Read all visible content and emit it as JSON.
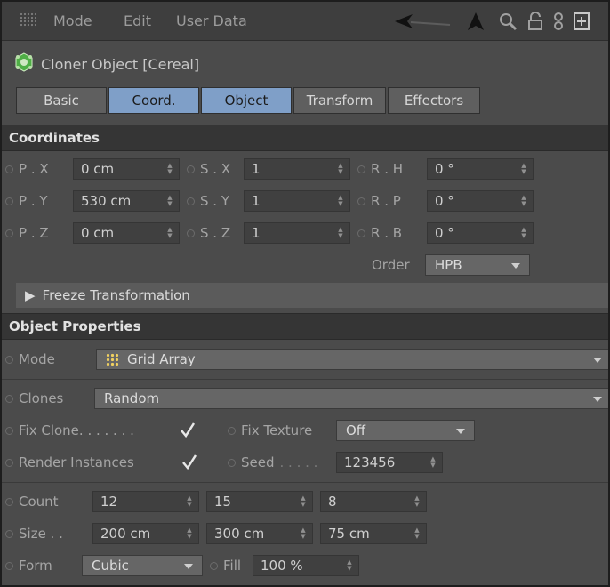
{
  "menubar": {
    "items": [
      "Mode",
      "Edit",
      "User Data"
    ],
    "icons": [
      "back-arrow-icon",
      "cursor-arrow-icon",
      "search-icon",
      "lock-icon",
      "link-icon",
      "new-panel-icon"
    ]
  },
  "object": {
    "title": "Cloner Object [Cereal]",
    "icon": "cloner-icon"
  },
  "tabs": [
    {
      "label": "Basic",
      "active": false
    },
    {
      "label": "Coord.",
      "active": true
    },
    {
      "label": "Object",
      "active": true
    },
    {
      "label": "Transform",
      "active": false
    },
    {
      "label": "Effectors",
      "active": false
    }
  ],
  "coordinates": {
    "header": "Coordinates",
    "rows": [
      {
        "p_label": "P . X",
        "p_value": "0 cm",
        "s_label": "S . X",
        "s_value": "1",
        "r_label": "R . H",
        "r_value": "0 °"
      },
      {
        "p_label": "P . Y",
        "p_value": "530 cm",
        "s_label": "S . Y",
        "s_value": "1",
        "r_label": "R . P",
        "r_value": "0 °"
      },
      {
        "p_label": "P . Z",
        "p_value": "0 cm",
        "s_label": "S . Z",
        "s_value": "1",
        "r_label": "R . B",
        "r_value": "0 °"
      }
    ],
    "order_label": "Order",
    "order_value": "HPB",
    "freeze_label": "Freeze Transformation"
  },
  "object_properties": {
    "header": "Object Properties",
    "mode_label": "Mode",
    "mode_value": "Grid Array",
    "clones_label": "Clones",
    "clones_value": "Random",
    "fix_clone_label": "Fix Clone. . . . . . .",
    "fix_clone_checked": true,
    "fix_texture_label": "Fix Texture",
    "fix_texture_value": "Off",
    "render_instances_label": "Render Instances",
    "render_instances_checked": true,
    "seed_label": "Seed",
    "seed_dots": ". . . . .",
    "seed_value": "123456",
    "count_label": "Count",
    "count_values": [
      "12",
      "15",
      "8"
    ],
    "size_label": "Size . .",
    "size_values": [
      "200 cm",
      "300 cm",
      "75 cm"
    ],
    "form_label": "Form",
    "form_value": "Cubic",
    "fill_label": "Fill",
    "fill_value": "100 %"
  },
  "colors": {
    "active_tab": "#7f9fc8",
    "panel_bg": "#4b4b4b",
    "header_bg": "#353535"
  }
}
